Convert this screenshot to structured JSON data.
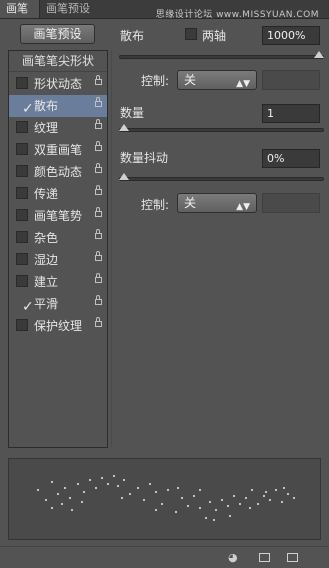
{
  "tabs": [
    {
      "label": "画笔"
    },
    {
      "label": "画笔预设"
    }
  ],
  "watermark": "思缘设计论坛 www.MISSYUAN.COM",
  "preset_button": "画笔预设",
  "tip_shape": "画笔笔尖形状",
  "options": [
    {
      "label": "形状动态",
      "checked": false,
      "selected": false
    },
    {
      "label": "散布",
      "checked": true,
      "selected": true
    },
    {
      "label": "纹理",
      "checked": false,
      "selected": false
    },
    {
      "label": "双重画笔",
      "checked": false,
      "selected": false
    },
    {
      "label": "颜色动态",
      "checked": false,
      "selected": false
    },
    {
      "label": "传递",
      "checked": false,
      "selected": false
    },
    {
      "label": "画笔笔势",
      "checked": false,
      "selected": false
    },
    {
      "label": "杂色",
      "checked": false,
      "selected": false
    },
    {
      "label": "湿边",
      "checked": false,
      "selected": false
    },
    {
      "label": "建立",
      "checked": false,
      "selected": false
    },
    {
      "label": "平滑",
      "checked": true,
      "selected": false
    },
    {
      "label": "保护纹理",
      "checked": false,
      "selected": false
    }
  ],
  "scatter": {
    "label": "散布",
    "both_axes_label": "两轴",
    "both_axes_checked": false,
    "value": "1000%",
    "slider_level": 1.0,
    "control_label": "控制:",
    "control_value": "关"
  },
  "count": {
    "label": "数量",
    "value": "1",
    "slider_level": 0.0
  },
  "count_jitter": {
    "label": "数量抖动",
    "value": "0%",
    "slider_level": 0.0,
    "control_label": "控制:",
    "control_value": "关"
  },
  "icons": [
    "eye-brush-icon",
    "grid-icon",
    "new-page-icon"
  ]
}
